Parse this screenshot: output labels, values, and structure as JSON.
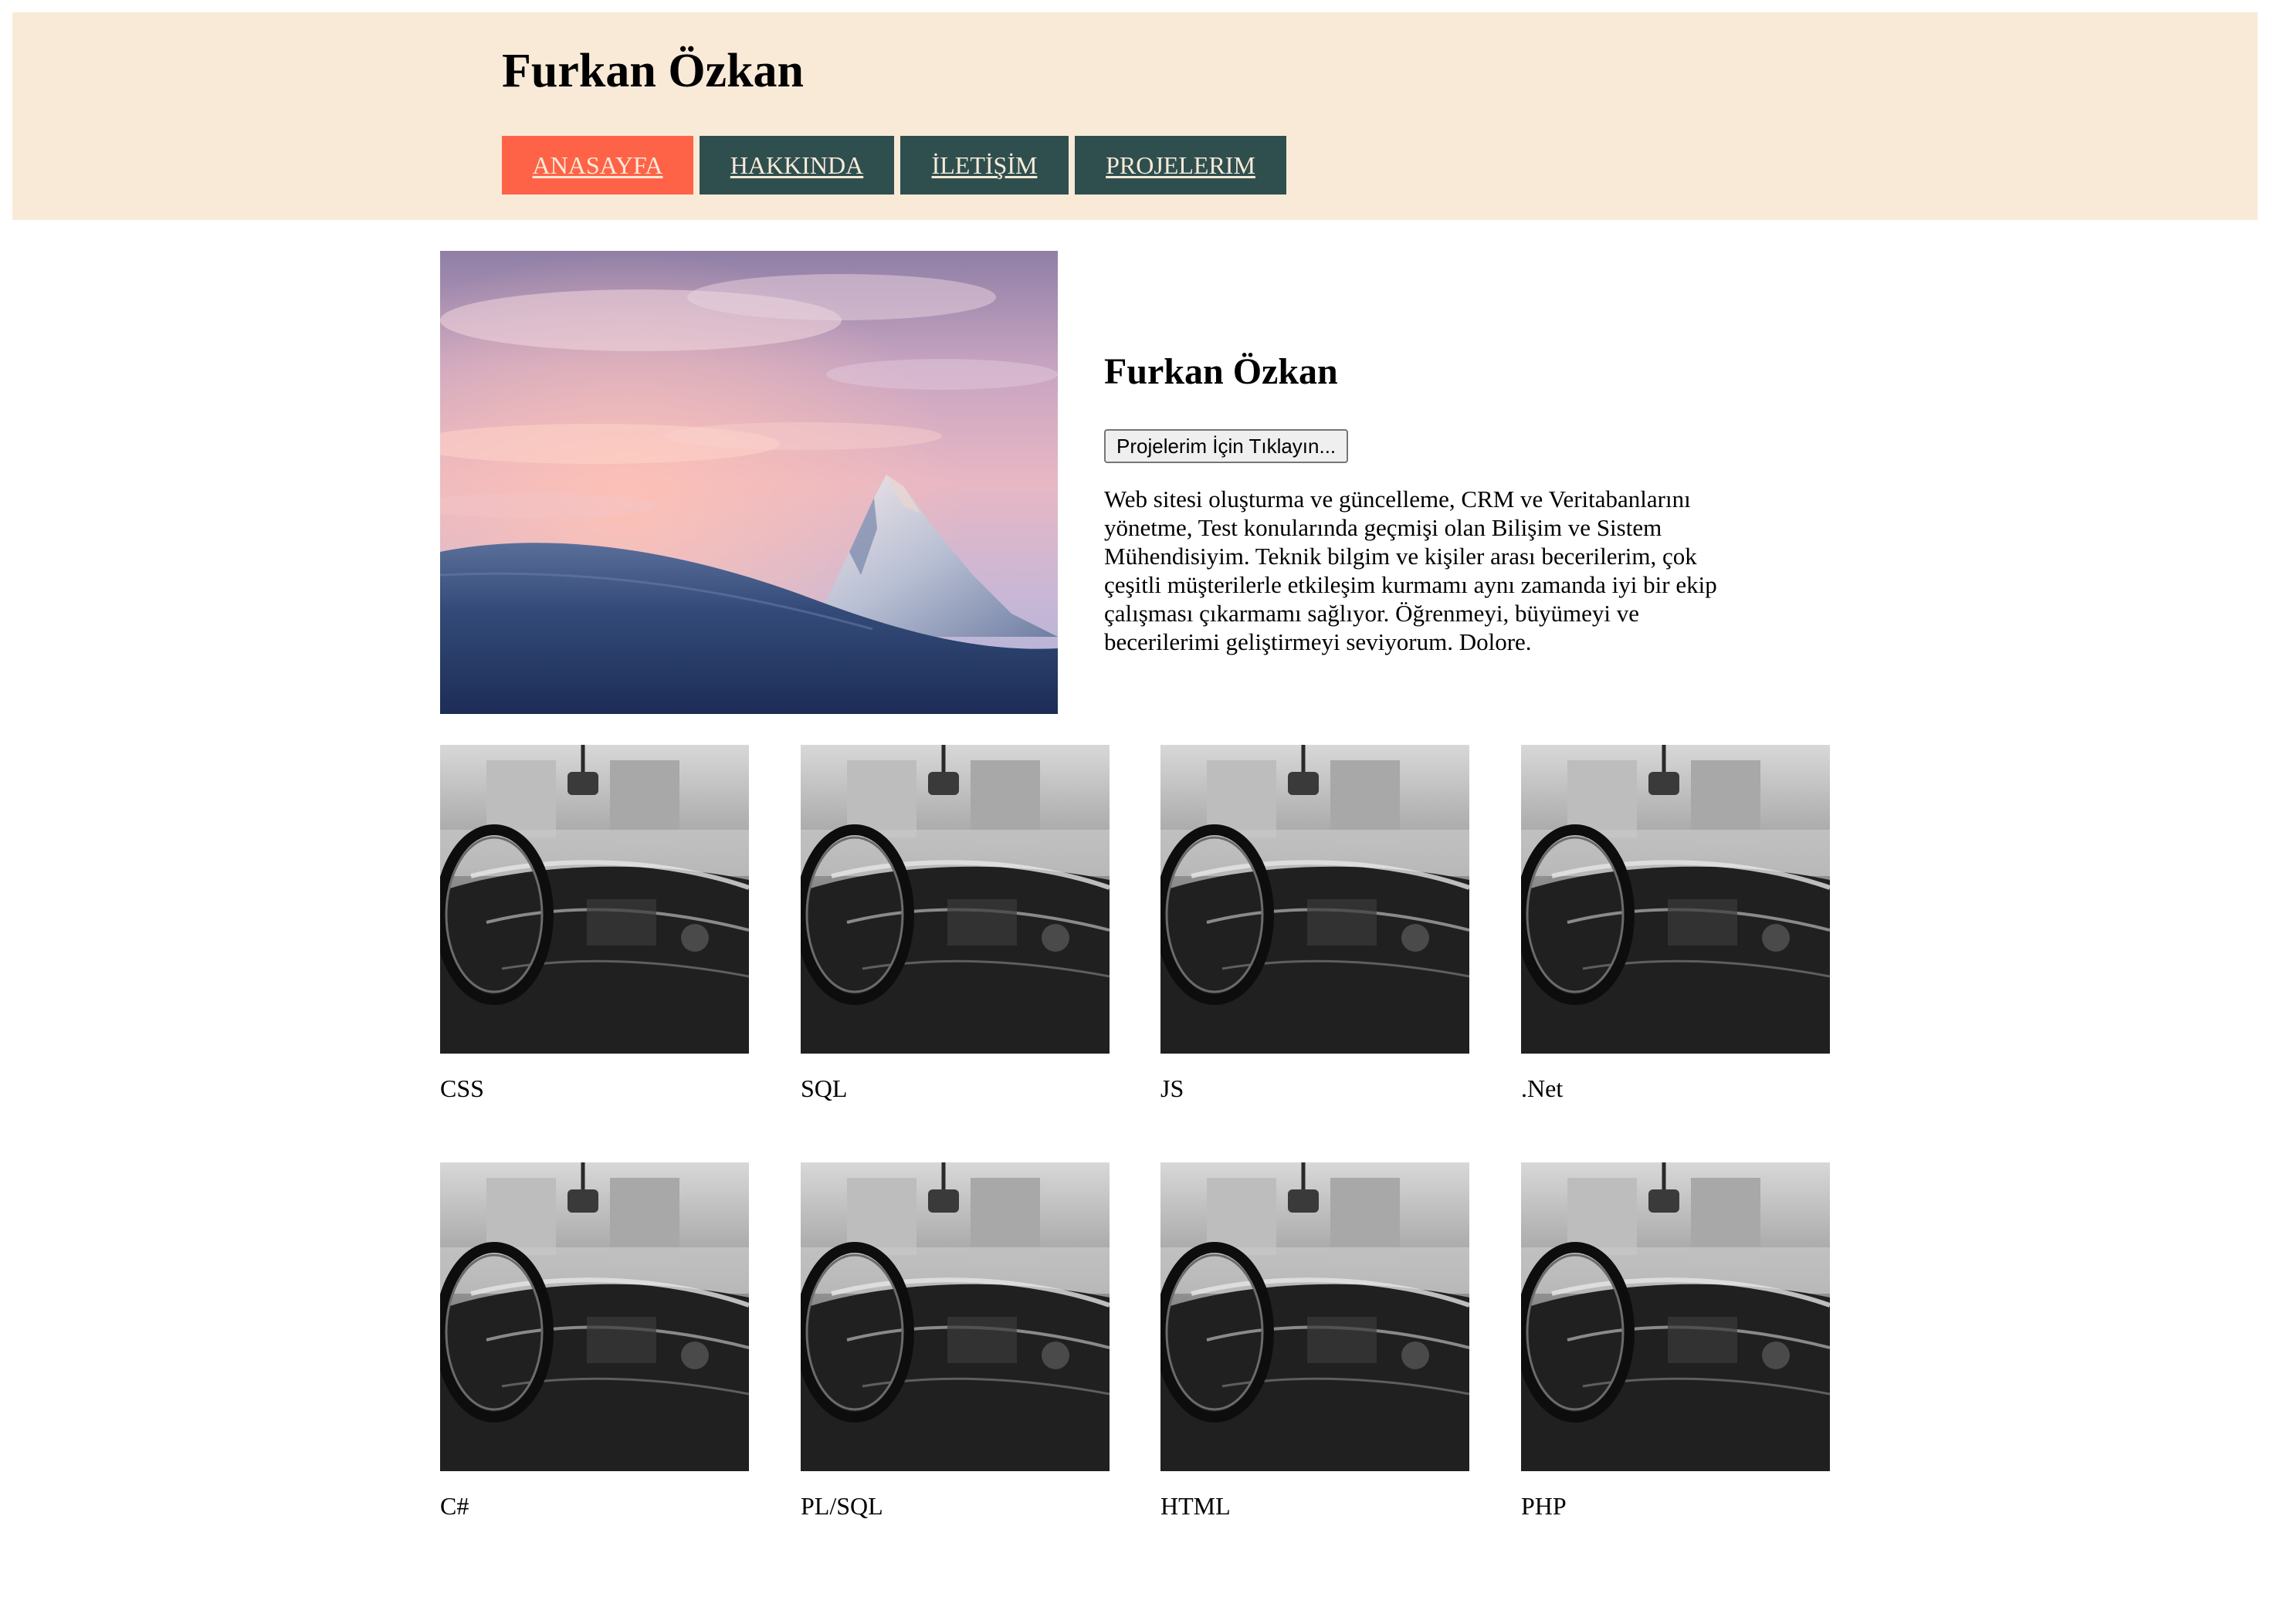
{
  "header": {
    "title": "Furkan Özkan",
    "nav": [
      {
        "label": "ANASAYFA",
        "active": true
      },
      {
        "label": "HAKKINDA",
        "active": false
      },
      {
        "label": "İLETİŞİM",
        "active": false
      },
      {
        "label": "PROJELERIM",
        "active": false
      }
    ]
  },
  "profile": {
    "name": "Furkan Özkan",
    "button_label": "Projelerim İçin Tıklayın...",
    "bio": "Web sitesi oluşturma ve güncelleme, CRM ve Veritabanlarını yönetme, Test konularında geçmişi olan Bilişim ve Sistem Mühendisiyim. Teknik bilgim ve kişiler arası becerilerim, çok çeşitli müşterilerle etkileşim kurmamı aynı zamanda iyi bir ekip çalışması çıkarmamı sağlıyor. Öğrenmeyi, büyümeyi ve becerilerimi geliştirmeyi seviyorum. Dolore."
  },
  "projects": [
    {
      "label": "CSS"
    },
    {
      "label": "SQL"
    },
    {
      "label": "JS"
    },
    {
      "label": ".Net"
    },
    {
      "label": "C#"
    },
    {
      "label": "PL/SQL"
    },
    {
      "label": "HTML"
    },
    {
      "label": "PHP"
    }
  ],
  "colors": {
    "header_bg": "#F9EAD8",
    "nav_bg": "#2F4F4F",
    "nav_active_bg": "#FF6347",
    "nav_text": "#F9EAD8"
  }
}
